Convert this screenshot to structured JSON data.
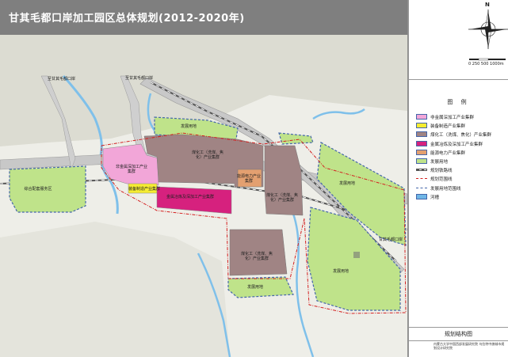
{
  "map": {
    "title": "甘其毛都口岸加工园区总体规划(2012-2020年)",
    "labels": {
      "port_road_left": "至甘其毛都口岸",
      "port_road_right": "至甘其毛都口岸",
      "develop_north": "发展用地",
      "nonferrous": "非金属深加工产业集群",
      "coal_chem_main": "煤化工（洗煤、焦化）产业集群",
      "equipment": "装备制造产业集群",
      "energy": "能源电力产业集群",
      "metal": "金属冶炼及深加工产业集群",
      "coal_chem_east": "煤化工（洗煤、焦化）产业集群",
      "coal_chem_south": "煤化工（洗煤、焦化）产业集群",
      "develop_far_east": "发展用地",
      "develop_southeast": "发展用地",
      "develop_south": "发展用地",
      "port_north_right": "甘其毛都口岸",
      "port_area_left": "综合配套服务区"
    }
  },
  "legend": {
    "title": "图 例",
    "items": [
      {
        "label": "非金属深加工产业集群",
        "color": "#f2a6d8"
      },
      {
        "label": "装备制造产业集群",
        "color": "#f5ec32"
      },
      {
        "label": "煤化工（洗煤、焦化）产业集群",
        "color": "#a08484"
      },
      {
        "label": "金属冶炼及深加工产业集群",
        "color": "#d6217e"
      },
      {
        "label": "能源电力产业集群",
        "color": "#e3a070"
      },
      {
        "label": "发展用地",
        "color": "#bfe38a"
      },
      {
        "label": "规划铁路线",
        "color": "#555555"
      },
      {
        "label": "规划范围线",
        "color": "#d42020"
      },
      {
        "label": "发展用地范围线",
        "color": "#4466aa"
      },
      {
        "label": "河槽",
        "color": "#6fb6e6"
      }
    ]
  },
  "compass": {
    "north": "N",
    "scale": "0 250 500    1000m"
  },
  "plan_name": "规划结构图",
  "credit": "内蒙古大学中国西部发展研究院 乌拉特中旗城市规划设计研究院"
}
